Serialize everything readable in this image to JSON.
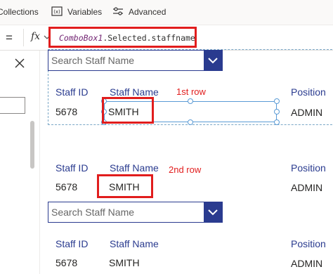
{
  "toolbar": {
    "collections_label": "Collections",
    "variables_label": "Variables",
    "advanced_label": "Advanced"
  },
  "formula_bar": {
    "property_symbol": "=",
    "fx_label": "fx",
    "formula_object": "ComboBox1",
    "formula_rest": ".Selected.staffname"
  },
  "canvas": {
    "combobox1": {
      "placeholder": "Search Staff Name"
    },
    "combobox2": {
      "placeholder": "Search Staff Name"
    },
    "row1": {
      "note": "1st row",
      "staff_id_header": "Staff ID",
      "staff_name_header": "Staff Name",
      "position_header": "Position",
      "staff_id": "5678",
      "staff_name": "SMITH",
      "position": "ADMIN"
    },
    "row2": {
      "note": "2nd row",
      "staff_id_header": "Staff ID",
      "staff_name_header": "Staff Name",
      "position_header": "Position",
      "staff_id": "5678",
      "staff_name": "SMITH",
      "position": "ADMIN"
    },
    "row3": {
      "staff_id_header": "Staff ID",
      "staff_name_header": "Staff Name",
      "position_header": "Position",
      "staff_id": "5678",
      "staff_name": "SMITH",
      "position": "ADMIN"
    }
  },
  "icons": {
    "variables": "variables-icon",
    "advanced": "sliders-icon",
    "close": "close-icon",
    "dropdown": "chevron-down-icon"
  },
  "colors": {
    "accent": "#2a3b8f",
    "highlight": "#e11d1d",
    "selection": "#5b9bd5"
  }
}
